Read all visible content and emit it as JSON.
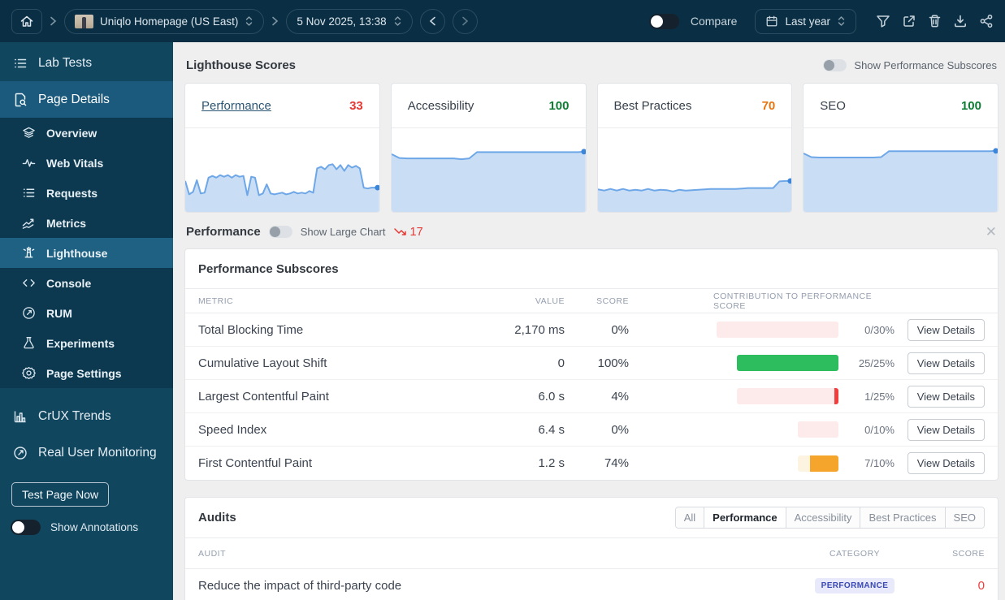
{
  "topbar": {
    "page_selector": "Uniqlo Homepage (US East)",
    "date_selector": "5 Nov 2025, 13:38",
    "compare_label": "Compare",
    "range_selector": "Last year"
  },
  "sidebar": {
    "lab_tests": "Lab Tests",
    "page_details": "Page Details",
    "children": [
      {
        "label": "Overview"
      },
      {
        "label": "Web Vitals"
      },
      {
        "label": "Requests"
      },
      {
        "label": "Metrics"
      },
      {
        "label": "Lighthouse"
      },
      {
        "label": "Console"
      },
      {
        "label": "RUM"
      },
      {
        "label": "Experiments"
      },
      {
        "label": "Page Settings"
      }
    ],
    "crux_trends": "CrUX Trends",
    "real_user_monitoring": "Real User Monitoring",
    "test_button": "Test Page Now",
    "annotations_label": "Show Annotations"
  },
  "main": {
    "title": "Lighthouse Scores",
    "subscores_toggle_label": "Show Performance Subscores",
    "performance_section": {
      "title": "Performance",
      "toggle_label": "Show Large Chart",
      "trend_value": "17",
      "trend_direction": "down",
      "trend_color": "#e53935"
    },
    "subscores": {
      "title": "Performance Subscores",
      "columns": [
        "METRIC",
        "VALUE",
        "SCORE",
        "CONTRIBUTION TO PERFORMANCE SCORE"
      ],
      "view_details_label": "View Details",
      "rows": [
        {
          "metric": "Total Blocking Time",
          "value": "2,170 ms",
          "score": "0%",
          "fraction": "0/30%",
          "max": 30,
          "fill": 0,
          "state": "fail"
        },
        {
          "metric": "Cumulative Layout Shift",
          "value": "0",
          "score": "100%",
          "fraction": "25/25%",
          "max": 25,
          "fill": 25,
          "state": "pass"
        },
        {
          "metric": "Largest Contentful Paint",
          "value": "6.0 s",
          "score": "4%",
          "fraction": "1/25%",
          "max": 25,
          "fill": 1,
          "state": "fail"
        },
        {
          "metric": "Speed Index",
          "value": "6.4 s",
          "score": "0%",
          "fraction": "0/10%",
          "max": 10,
          "fill": 0,
          "state": "fail"
        },
        {
          "metric": "First Contentful Paint",
          "value": "1.2 s",
          "score": "74%",
          "fraction": "7/10%",
          "max": 10,
          "fill": 7,
          "state": "average"
        }
      ]
    },
    "audits": {
      "title": "Audits",
      "tabs": [
        "All",
        "Performance",
        "Accessibility",
        "Best Practices",
        "SEO"
      ],
      "active_tab": "Performance",
      "columns": [
        "AUDIT",
        "CATEGORY",
        "SCORE"
      ],
      "rows": [
        {
          "audit": "Reduce the impact of third-party code",
          "category": "PERFORMANCE",
          "score": "0",
          "score_color": "#f23d3d"
        }
      ]
    }
  },
  "chart_data": [
    {
      "type": "area",
      "title": "Performance score over last year",
      "ylim": [
        0,
        100
      ],
      "current": 33,
      "values": [
        37,
        21,
        24,
        38,
        22,
        23,
        41,
        43,
        41,
        44,
        42,
        44,
        41,
        44,
        42,
        43,
        20,
        42,
        41,
        20,
        22,
        33,
        22,
        21,
        22,
        23,
        21,
        22,
        24,
        22,
        23,
        22,
        25,
        23,
        52,
        54,
        51,
        56,
        57,
        51,
        56,
        49,
        56,
        53,
        55,
        52,
        29,
        28,
        29,
        29,
        29
      ]
    },
    {
      "type": "area",
      "title": "Accessibility score over last year",
      "ylim": [
        0,
        100
      ],
      "current": 100,
      "values": [
        69,
        64.5,
        64,
        64,
        64,
        64,
        64,
        64,
        64,
        63,
        64,
        71.5,
        71.5,
        71.5,
        71.5,
        71.5,
        71.5,
        71.5,
        71.5,
        71.5,
        71.5,
        71.5,
        71.5,
        71.5,
        71.5,
        72
      ]
    },
    {
      "type": "area",
      "title": "Best Practices score over last year",
      "ylim": [
        0,
        100
      ],
      "current": 70,
      "values": [
        27,
        25.5,
        27.5,
        25.5,
        27.5,
        25.5,
        26.5,
        25.5,
        27.5,
        25.5,
        26.5,
        26,
        24.5,
        26.5,
        25.5,
        26,
        26.5,
        27,
        27.5,
        27.5,
        27.5,
        27.5,
        27.5,
        28,
        28.5,
        28.5,
        28.5,
        28.5,
        28.5,
        36.5,
        37,
        37
      ]
    },
    {
      "type": "area",
      "title": "SEO score over last year",
      "ylim": [
        0,
        100
      ],
      "current": 100,
      "values": [
        70,
        65.5,
        65,
        65,
        65,
        65,
        65,
        65,
        65,
        65,
        65.5,
        72.5,
        72.5,
        72.5,
        72.5,
        72.5,
        72.5,
        72.5,
        72.5,
        72.5,
        72.5,
        72.5,
        72.5,
        72.5,
        72.5,
        73
      ]
    }
  ],
  "score_cards": [
    {
      "label": "Performance",
      "score": "33",
      "score_color": "#e53935",
      "link": true
    },
    {
      "label": "Accessibility",
      "score": "100",
      "score_color": "#0c7d33",
      "link": false
    },
    {
      "label": "Best Practices",
      "score": "70",
      "score_color": "#e8730c",
      "link": false
    },
    {
      "label": "SEO",
      "score": "100",
      "score_color": "#0c7d33",
      "link": false
    }
  ]
}
